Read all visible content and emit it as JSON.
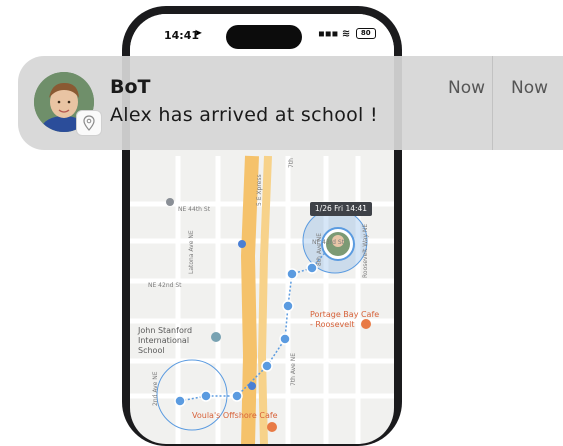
{
  "status_bar": {
    "time": "14:41",
    "battery": "80"
  },
  "notification": {
    "app_name": "BoT",
    "message": "Alex has arrived at school !",
    "timestamp_1": "Now",
    "timestamp_2": "Now"
  },
  "map": {
    "tooltip": "1/26 Fri 14:41",
    "street_labels": [
      "NE 44th St",
      "NE 43rd St",
      "NE 42nd St",
      "5 E Xpress",
      "Roosevelt Way NE",
      "7th Ave NE",
      "2nd Ave NE",
      "Latona Ave NE",
      "8th Ave NE",
      "7th"
    ],
    "pois": {
      "portage_bay": "Portage Bay Cafe - Roosevelt",
      "school": "John Stanford International School",
      "offshore": "Voula's Offshore Cafe"
    },
    "colors": {
      "route": "#5b9be0",
      "freeway": "#f5c26b",
      "poi": "#d7623a"
    }
  }
}
